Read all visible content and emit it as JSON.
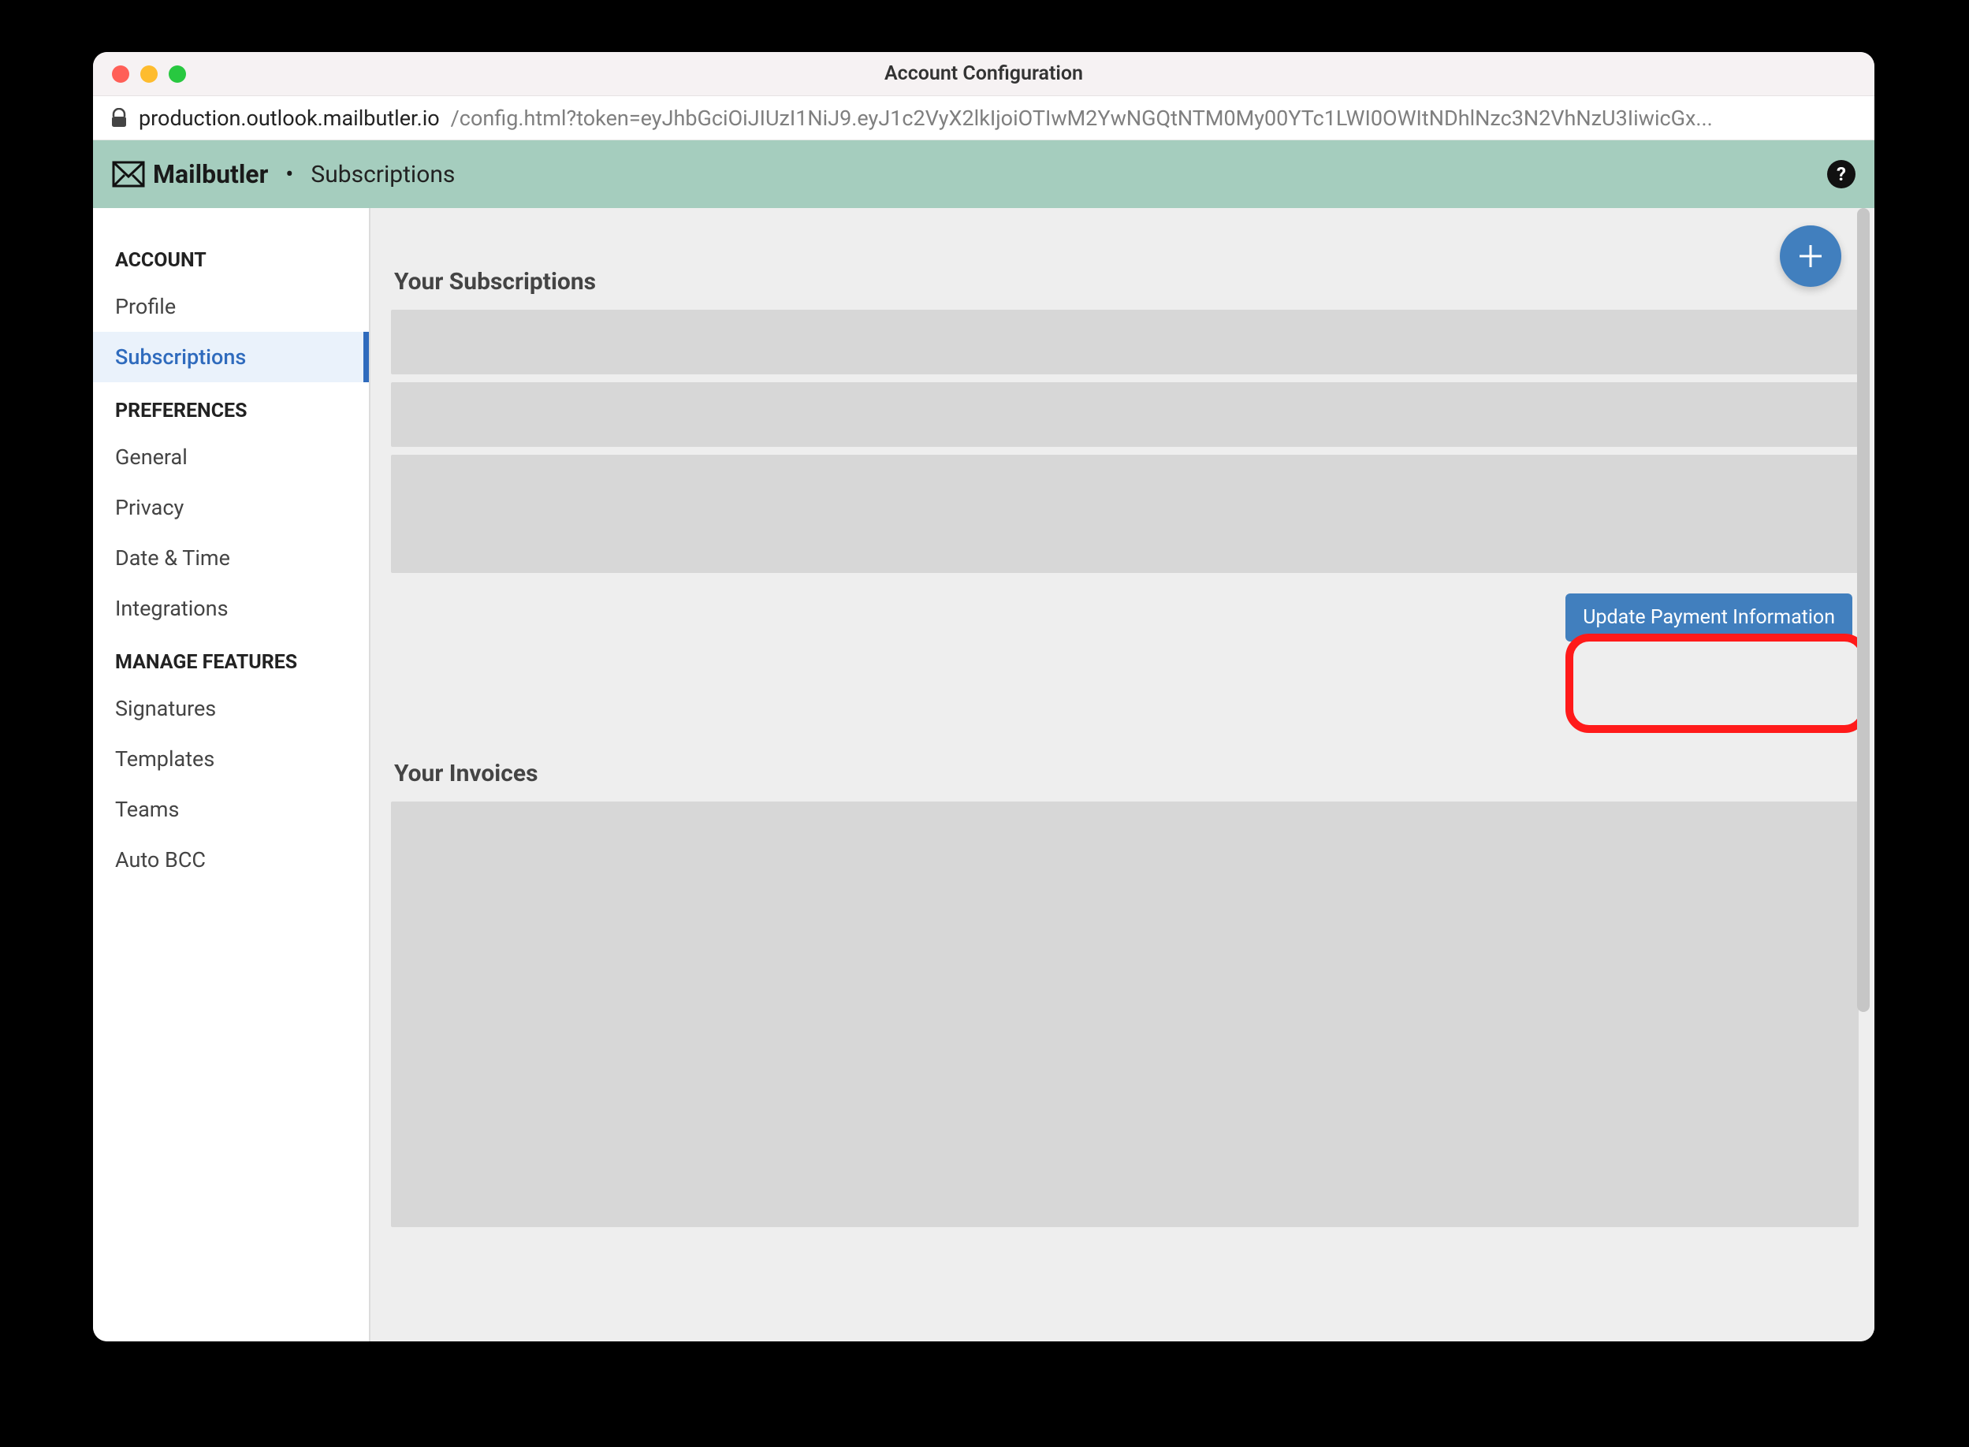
{
  "window": {
    "title": "Account Configuration",
    "url_host": "production.outlook.mailbutler.io",
    "url_path": "/config.html?token=eyJhbGciOiJIUzI1NiJ9.eyJ1c2VyX2lkIjoiOTIwM2YwNGQtNTM0My00YTc1LWI0OWItNDhlNzc3N2VhNzU3IiwicGx..."
  },
  "brand": {
    "name": "Mailbutler",
    "crumb": "Subscriptions"
  },
  "sidebar": {
    "groups": [
      {
        "title": "ACCOUNT",
        "items": [
          "Profile",
          "Subscriptions"
        ]
      },
      {
        "title": "PREFERENCES",
        "items": [
          "General",
          "Privacy",
          "Date & Time",
          "Integrations"
        ]
      },
      {
        "title": "MANAGE FEATURES",
        "items": [
          "Signatures",
          "Templates",
          "Teams",
          "Auto BCC"
        ]
      }
    ],
    "active": "Subscriptions"
  },
  "main": {
    "subscriptions_heading": "Your Subscriptions",
    "update_payment_label": "Update Payment Information",
    "invoices_heading": "Your Invoices"
  },
  "colors": {
    "brandbar": "#a5cdbe",
    "accent": "#417fbe",
    "sidebar_active_bg": "#eaf2fb",
    "sidebar_active_fg": "#2f6bbd",
    "callout_border": "#ff1a1a"
  }
}
